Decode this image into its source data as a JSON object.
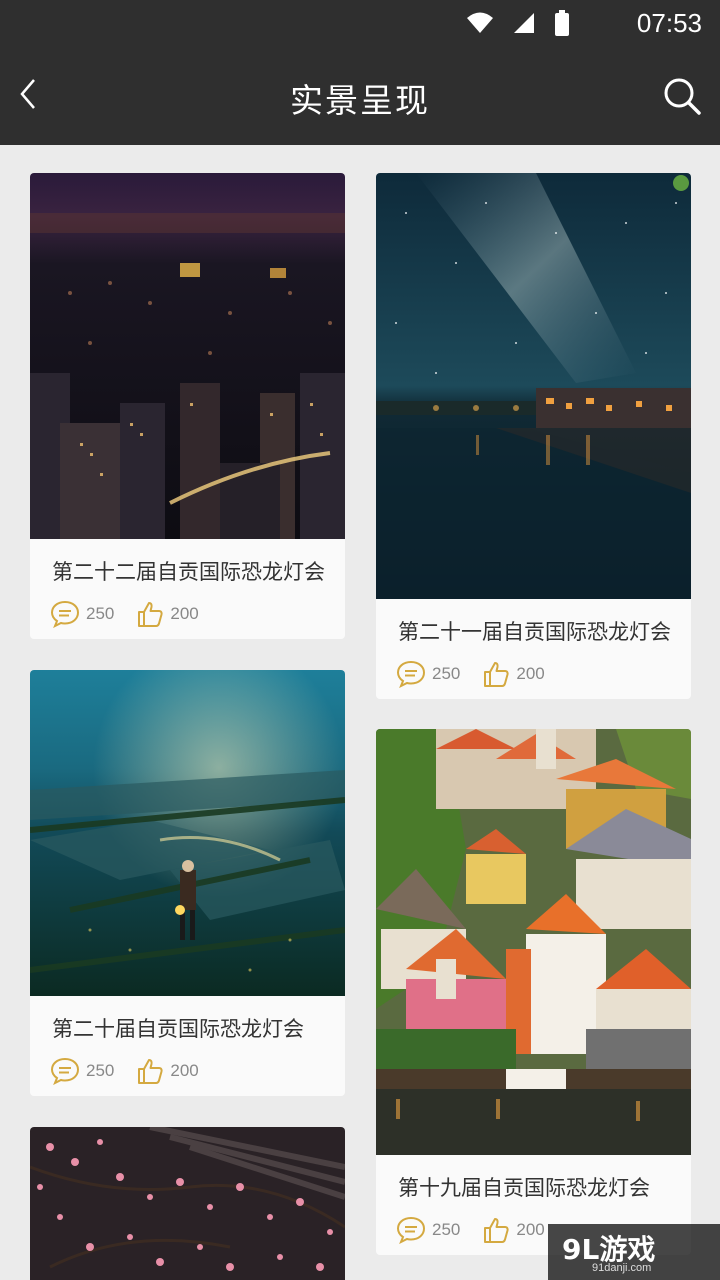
{
  "status_bar": {
    "time": "07:53",
    "icons": [
      "wifi-icon",
      "signal-icon",
      "battery-icon"
    ]
  },
  "app_bar": {
    "title": "实景呈现",
    "back_icon": "chevron-left-icon",
    "search_icon": "search-icon"
  },
  "cards": [
    {
      "title": "第二十二届自贡国际恐龙灯会",
      "comments": "250",
      "likes": "200",
      "image": "city-night-skyline"
    },
    {
      "title": "第二十一届自贡国际恐龙灯会",
      "comments": "250",
      "likes": "200",
      "image": "milky-way-over-river-town"
    },
    {
      "title": "第二十届自贡国际恐龙灯会",
      "comments": "250",
      "likes": "200",
      "image": "crescent-moon-rice-fields"
    },
    {
      "title": "第十九届自贡国际恐龙灯会",
      "comments": "250",
      "likes": "200",
      "image": "colorful-old-town-rooftops"
    },
    {
      "title": "",
      "comments": "",
      "likes": "",
      "image": "plum-blossoms-roof-tiles"
    }
  ],
  "colors": {
    "app_bar": "#2f2f2f",
    "background": "#ebebeb",
    "icon_accent": "#d4a940"
  },
  "watermark": {
    "logo": "9L游戏",
    "url": "91danji.com"
  }
}
